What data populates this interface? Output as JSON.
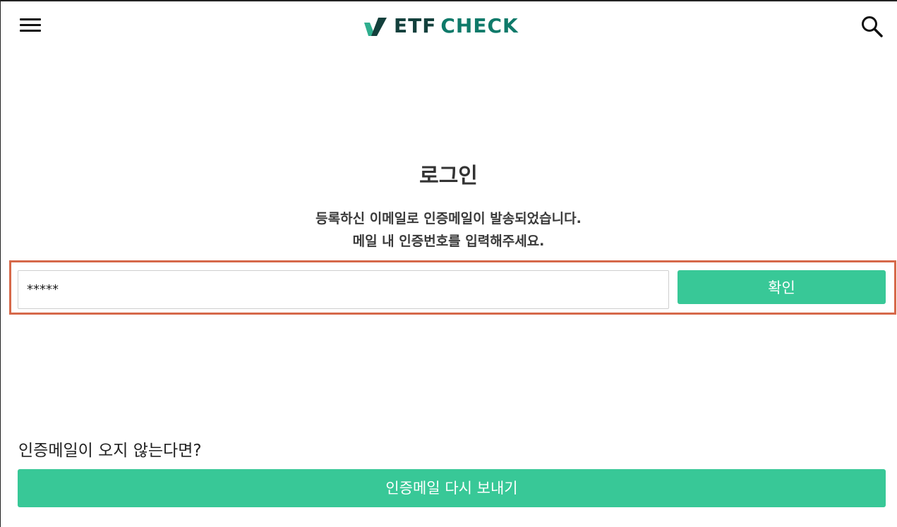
{
  "header": {
    "menu_icon": "hamburger-menu-icon",
    "logo": {
      "mark_icon": "check-mark-logo-icon",
      "text_part1": "ETF",
      "text_part2": "CHECK",
      "color_dark": "#13403c",
      "color_teal": "#0f7a6a",
      "mark_color_light": "#2fae8e",
      "mark_color_dark": "#13403c"
    },
    "search_icon": "search-icon"
  },
  "login": {
    "title": "로그인",
    "description_line1": "등록하신 이메일로 인증메일이 발송되었습니다.",
    "description_line2": "메일 내 인증번호를 입력해주세요.",
    "code_input_value": "*****",
    "confirm_label": "확인"
  },
  "resend": {
    "question": "인증메일이 오지 않는다면?",
    "button_label": "인증메일 다시 보내기"
  },
  "colors": {
    "accent": "#38c897",
    "highlight_border": "#d6694a"
  }
}
